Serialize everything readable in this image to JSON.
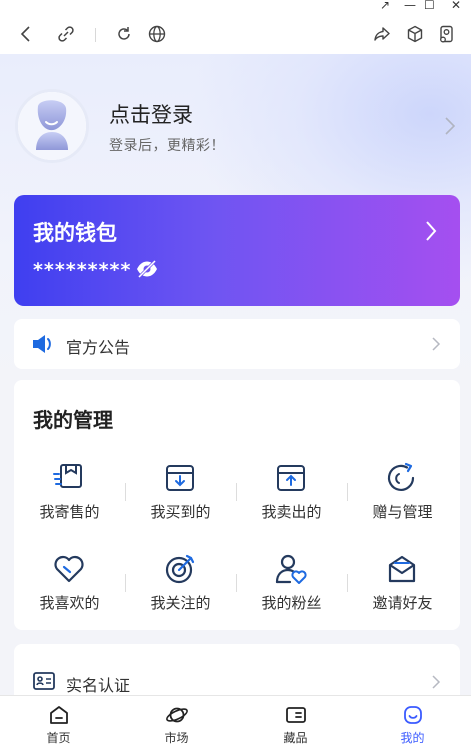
{
  "window": {
    "restore_glyph": "↗",
    "minimize_glyph": "—",
    "maximize_glyph": "☐",
    "close_glyph": "✕"
  },
  "browser": {
    "icons": [
      "back-icon",
      "link-icon",
      "refresh-icon",
      "globe-icon",
      "share-icon",
      "cube-icon",
      "user-settings-icon"
    ]
  },
  "profile": {
    "title": "点击登录",
    "subtitle": "登录后，更精彩！"
  },
  "wallet": {
    "title": "我的钱包",
    "masked_balance": "*********"
  },
  "notice": {
    "label": "官方公告"
  },
  "management": {
    "title": "我的管理",
    "items": [
      {
        "label": "我寄售的",
        "icon": "consign-box-icon"
      },
      {
        "label": "我买到的",
        "icon": "inbox-download-icon"
      },
      {
        "label": "我卖出的",
        "icon": "inbox-upload-icon"
      },
      {
        "label": "赠与管理",
        "icon": "gift-refresh-icon"
      },
      {
        "label": "我喜欢的",
        "icon": "heart-icon"
      },
      {
        "label": "我关注的",
        "icon": "target-icon"
      },
      {
        "label": "我的粉丝",
        "icon": "user-heart-icon"
      },
      {
        "label": "邀请好友",
        "icon": "mail-open-icon"
      }
    ]
  },
  "realname": {
    "label": "实名认证"
  },
  "tabs": [
    {
      "label": "首页",
      "icon": "home-icon"
    },
    {
      "label": "市场",
      "icon": "planet-icon"
    },
    {
      "label": "藏品",
      "icon": "card-icon"
    },
    {
      "label": "我的",
      "icon": "smile-icon",
      "active": true
    }
  ],
  "colors": {
    "accent": "#3b5bff",
    "icon_blue": "#1e6ae0",
    "icon_dark": "#243a5e",
    "wallet_start": "#3f3ff0",
    "wallet_end": "#a54ff0"
  }
}
